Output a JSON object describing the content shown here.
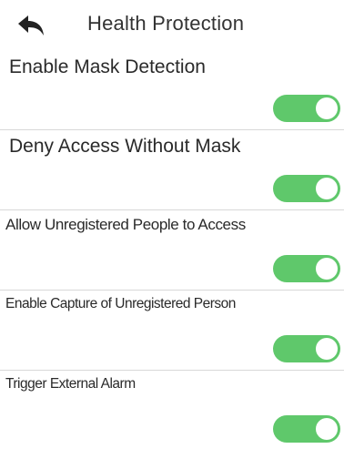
{
  "header": {
    "title": "Health Protection",
    "back_icon": "back-arrow-icon"
  },
  "settings": [
    {
      "label": "Enable Mask Detection",
      "enabled": true
    },
    {
      "label": "Deny Access Without Mask",
      "enabled": true
    },
    {
      "label": "Allow Unregistered People to Access",
      "enabled": true
    },
    {
      "label": "Enable Capture of Unregistered Person",
      "enabled": true
    },
    {
      "label": "Trigger External Alarm",
      "enabled": true
    }
  ],
  "colors": {
    "toggle_on": "#5fc86b",
    "divider": "#d8d8d8"
  }
}
